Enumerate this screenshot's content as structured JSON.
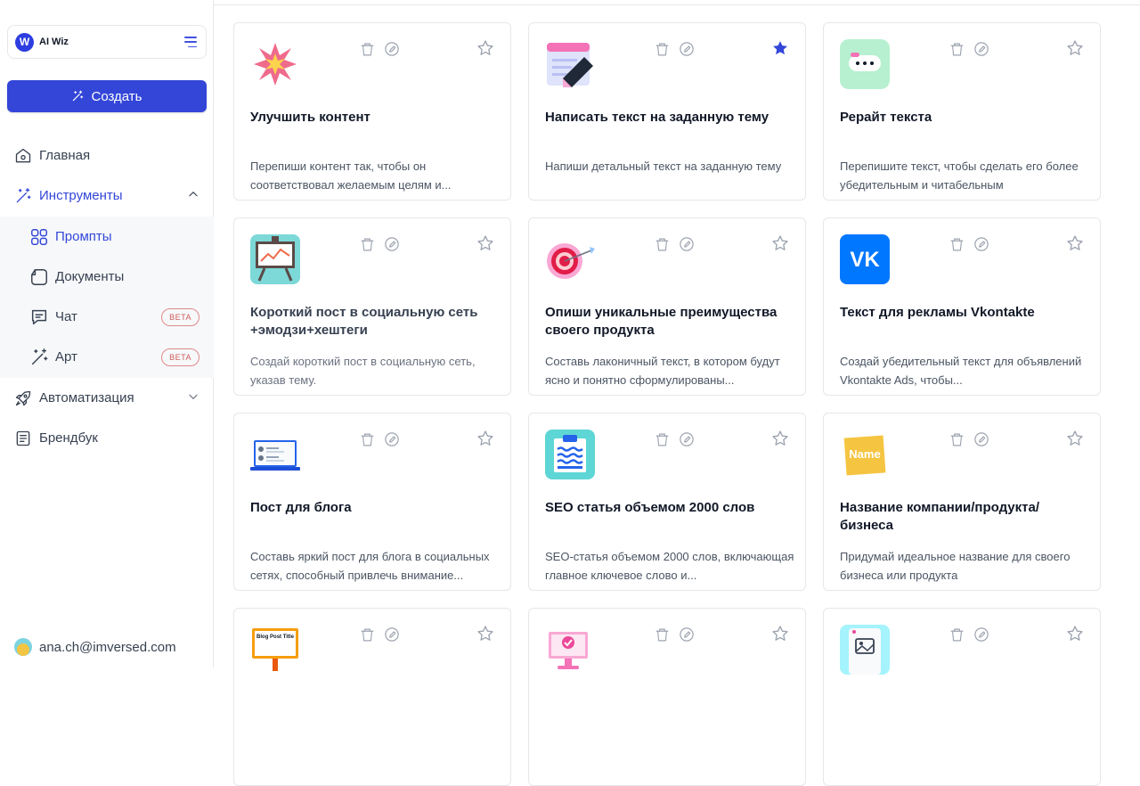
{
  "workspace": {
    "name": "AI Wiz",
    "logo_letter": "W"
  },
  "create_button": {
    "label": "Создать"
  },
  "nav": {
    "home": "Главная",
    "tools": "Инструменты",
    "tools_sub": {
      "prompts": "Промпты",
      "documents": "Документы",
      "chat": "Чат",
      "chat_badge": "BETA",
      "art": "Арт",
      "art_badge": "BETA"
    },
    "automation": "Автоматизация",
    "brandbook": "Брендбук"
  },
  "user": {
    "email": "ana.ch@imversed.com"
  },
  "colors": {
    "accent": "#3346d8",
    "beta": "#d15c5c",
    "star_filled": "#3346d8"
  },
  "cards": [
    {
      "title": "Улучшить контент",
      "desc": "Перепиши контент так, чтобы он соответствовал желаемым целям и...",
      "icon": "sparkle-burst-icon",
      "starred": false
    },
    {
      "title": "Написать текст на заданную тему",
      "desc": "Напиши детальный текст на заданную тему",
      "icon": "notepad-pencil-icon",
      "starred": true
    },
    {
      "title": "Рерайт текста",
      "desc": "Перепишите текст, чтобы сделать его более убедительным и читабельным",
      "icon": "chat-bubble-icon",
      "starred": false
    },
    {
      "title": "Короткий пост в социальную сеть +эмодзи+хештеги",
      "desc": "Создай короткий пост в социальную сеть, указав тему.",
      "icon": "presentation-board-icon",
      "starred": false
    },
    {
      "title": "Опиши уникальные преимущества своего продукта",
      "desc": "Составь лаконичный текст, в котором будут ясно и понятно сформулированы...",
      "icon": "target-dart-icon",
      "starred": false
    },
    {
      "title": "Текст для рекламы Vkontakte",
      "desc": "Создай убедительный текст для объявлений Vkontakte Ads, чтобы...",
      "icon": "vk-logo-icon",
      "starred": false
    },
    {
      "title": "Пост для блога",
      "desc": "Составь яркий пост для блога в социальных сетях, способный привлечь внимание...",
      "icon": "laptop-icon",
      "starred": false
    },
    {
      "title": "SEO статья объемом 2000 слов",
      "desc": "SEO-статья объемом 2000 слов, включающая главное ключевое слово и...",
      "icon": "clipboard-waves-icon",
      "starred": false
    },
    {
      "title": "Название компании/продукта/бизнеса",
      "desc": "Придумай идеальное название для своего бизнеса или продукта",
      "icon": "name-tag-icon",
      "name_tag_text": "Name",
      "starred": false
    },
    {
      "title": "",
      "desc": "",
      "icon": "blog-post-sign-icon",
      "sign_text": "Blog Post Title",
      "starred": false
    },
    {
      "title": "",
      "desc": "",
      "icon": "monitor-check-icon",
      "starred": false
    },
    {
      "title": "",
      "desc": "",
      "icon": "phone-image-icon",
      "starred": false
    }
  ]
}
